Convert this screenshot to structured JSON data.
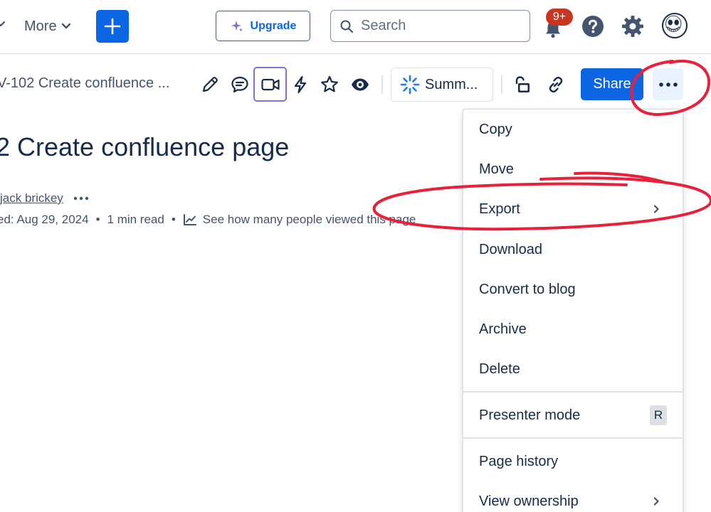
{
  "nav": {
    "more_label": "More",
    "upgrade_label": "Upgrade",
    "search_placeholder": "Search",
    "notification_count": "9+"
  },
  "toolbar": {
    "breadcrumb": "V-102 Create confluence ...",
    "summarize_label": "Summ...",
    "share_label": "Share"
  },
  "page": {
    "title": "2 Create confluence page",
    "author": "jack brickey",
    "updated": "ed: Aug 29, 2024",
    "read_time": "1 min read",
    "views_text": "See how many people viewed this page",
    "separator": "•"
  },
  "menu": {
    "items": [
      {
        "label": "Copy"
      },
      {
        "label": "Move"
      },
      {
        "label": "Export"
      },
      {
        "label": "Download"
      },
      {
        "label": "Convert to blog"
      },
      {
        "label": "Archive"
      },
      {
        "label": "Delete"
      },
      {
        "label": "Presenter mode",
        "shortcut": "R"
      },
      {
        "label": "Page history"
      },
      {
        "label": "View ownership"
      }
    ]
  },
  "colors": {
    "primary": "#0c66e4",
    "annotation": "#e8203a",
    "video_border": "#8270db",
    "badge": "#ca3521",
    "text": "#172b4d"
  }
}
